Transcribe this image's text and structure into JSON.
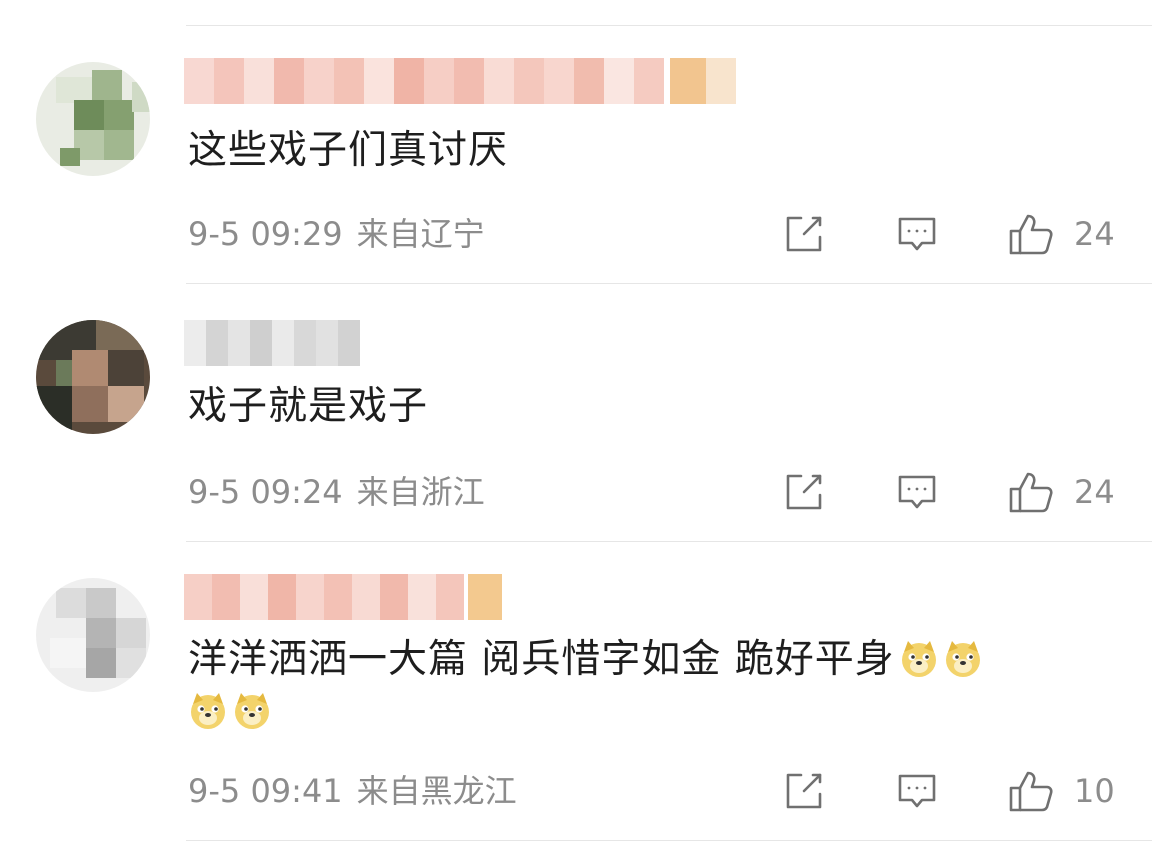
{
  "comments": [
    {
      "content": "这些戏子们真讨厌",
      "time": "9-5 09:29",
      "location": "来自辽宁",
      "likes": "24",
      "emoji_count": 0
    },
    {
      "content": "戏子就是戏子",
      "time": "9-5 09:24",
      "location": "来自浙江",
      "likes": "24",
      "emoji_count": 0
    },
    {
      "content": "洋洋洒洒一大篇  阅兵惜字如金 跪好平身",
      "time": "9-5 09:41",
      "location": "来自黑龙江",
      "likes": "10",
      "emoji_count": 4
    }
  ],
  "icons": {
    "repost": "repost-icon",
    "comment": "comment-icon",
    "like": "thumbs-up-icon",
    "emoji": "doge-emoji"
  },
  "colors": {
    "text": "#1e1e1e",
    "meta": "#8c8c8c",
    "divider": "#e6e6e6",
    "icon": "#707070"
  }
}
